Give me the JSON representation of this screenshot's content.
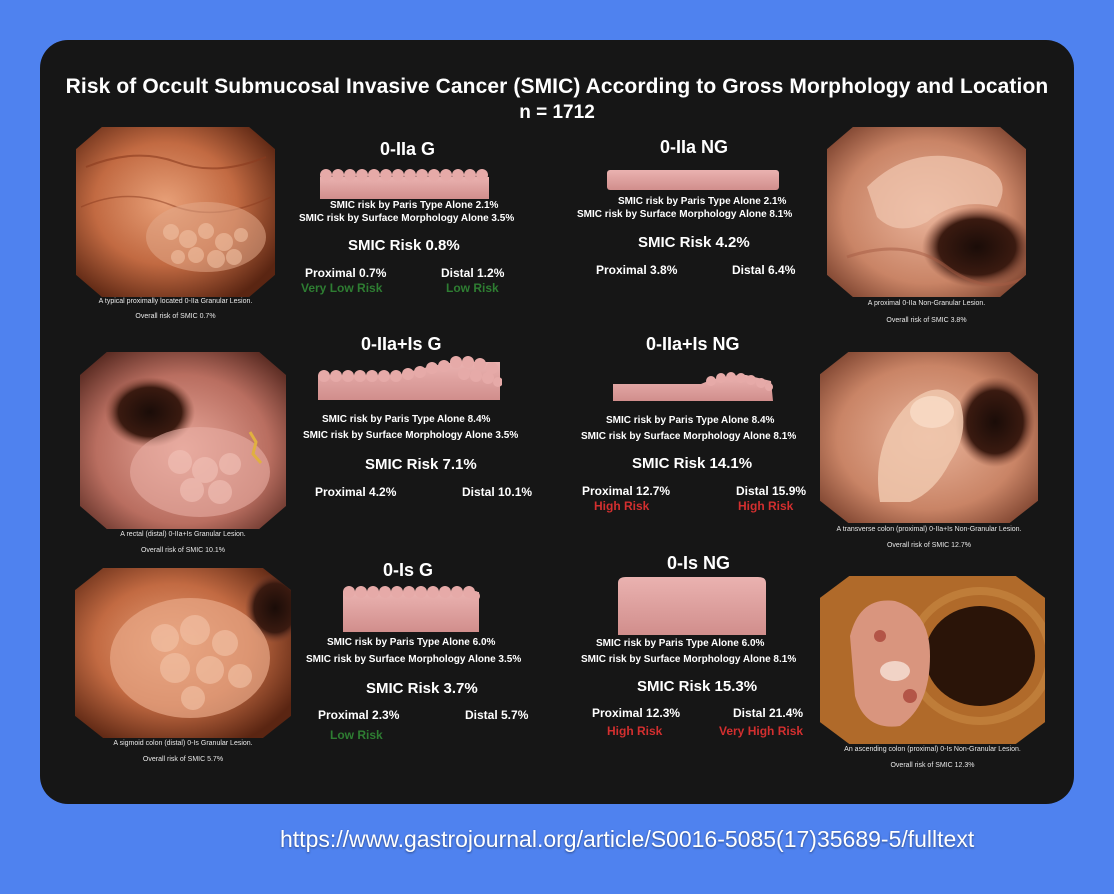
{
  "title": "Risk of Occult Submucosal Invasive Cancer (SMIC) According to Gross Morphology and Location",
  "subtitle": "n = 1712",
  "source_url": "https://www.gastrojournal.org/article/S0016-5085(17)35689-5/fulltext",
  "colors": {
    "background": "#4f82ef",
    "card": "#161616",
    "lesion_shape": "#e3a3a3",
    "low_risk": "#2e7d32",
    "high_risk": "#d32f2f"
  },
  "photos": {
    "p1": {
      "caption1": "A typical proximally located 0-IIa Granular Lesion.",
      "caption2": "Overall risk of SMIC 0.7%"
    },
    "p2": {
      "caption1": "A proximal 0-IIa Non-Granular Lesion.",
      "caption2": "Overall risk of SMIC 3.8%"
    },
    "p3": {
      "caption1": "A rectal (distal) 0-IIa+Is Granular Lesion.",
      "caption2": "Overall risk of SMIC 10.1%"
    },
    "p4": {
      "caption1": "A transverse colon (proximal) 0-IIa+Is Non-Granular Lesion.",
      "caption2": "Overall risk of SMIC 12.7%"
    },
    "p5": {
      "caption1": "A sigmoid colon (distal) 0-Is Granular Lesion.",
      "caption2": "Overall risk of SMIC 5.7%"
    },
    "p6": {
      "caption1": "An ascending colon (proximal) 0-Is Non-Granular Lesion.",
      "caption2": "Overall risk of SMIC 12.3%"
    }
  },
  "panels": {
    "iia_g": {
      "title": "0-IIa G",
      "paris": "SMIC risk by Paris Type Alone  2.1%",
      "surface": "SMIC risk by Surface Morphology Alone 3.5%",
      "risk": "SMIC Risk  0.8%",
      "proximal": "Proximal 0.7%",
      "distal": "Distal 1.2%",
      "proximal_grade": "Very Low Risk",
      "distal_grade": "Low Risk"
    },
    "iia_ng": {
      "title": "0-IIa NG",
      "paris": "SMIC risk by Paris Type Alone  2.1%",
      "surface": "SMIC risk by Surface Morphology Alone 8.1%",
      "risk": "SMIC Risk  4.2%",
      "proximal": "Proximal 3.8%",
      "distal": "Distal 6.4%"
    },
    "iiais_g": {
      "title": "0-IIa+Is G",
      "paris": "SMIC risk by Paris Type Alone  8.4%",
      "surface": "SMIC risk by Surface Morphology Alone 3.5%",
      "risk": "SMIC Risk  7.1%",
      "proximal": "Proximal 4.2%",
      "distal": "Distal 10.1%"
    },
    "iiais_ng": {
      "title": "0-IIa+Is NG",
      "paris": "SMIC risk by Paris Type Alone  8.4%",
      "surface": "SMIC risk by Surface Morphology Alone 8.1%",
      "risk": "SMIC Risk  14.1%",
      "proximal": "Proximal 12.7%",
      "distal": "Distal 15.9%",
      "proximal_grade": "High Risk",
      "distal_grade": "High Risk"
    },
    "is_g": {
      "title": "0-Is G",
      "paris": "SMIC risk by Paris Type Alone  6.0%",
      "surface": "SMIC risk by Surface Morphology Alone 3.5%",
      "risk": "SMIC Risk  3.7%",
      "proximal": "Proximal 2.3%",
      "distal": "Distal 5.7%",
      "proximal_grade": "Low Risk"
    },
    "is_ng": {
      "title": "0-Is NG",
      "paris": "SMIC risk by Paris Type Alone  6.0%",
      "surface": "SMIC risk by Surface Morphology Alone 8.1%",
      "risk": "SMIC Risk  15.3%",
      "proximal": "Proximal 12.3%",
      "distal": "Distal 21.4%",
      "proximal_grade": "High Risk",
      "distal_grade": "Very High Risk"
    }
  }
}
